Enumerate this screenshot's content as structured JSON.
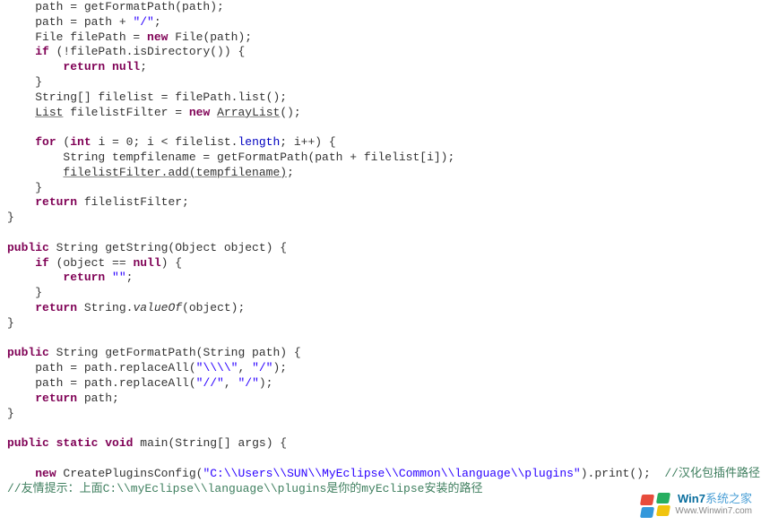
{
  "watermark": {
    "brand_prefix": "Win7",
    "brand_suffix": "系统之家",
    "url": "Www.Winwin7.com"
  },
  "lines": [
    {
      "indent": 4,
      "runs": [
        {
          "t": "path = getFormatPath(path);"
        }
      ]
    },
    {
      "indent": 4,
      "runs": [
        {
          "t": "path = path + "
        },
        {
          "t": "\"/\"",
          "cls": "str"
        },
        {
          "t": ";"
        }
      ]
    },
    {
      "indent": 4,
      "runs": [
        {
          "t": "File filePath = "
        },
        {
          "t": "new",
          "cls": "kw"
        },
        {
          "t": " File(path);"
        }
      ]
    },
    {
      "indent": 4,
      "runs": [
        {
          "t": "if",
          "cls": "kw"
        },
        {
          "t": " (!filePath.isDirectory()) {"
        }
      ]
    },
    {
      "indent": 8,
      "runs": [
        {
          "t": "return null",
          "cls": "kw"
        },
        {
          "t": ";"
        }
      ]
    },
    {
      "indent": 4,
      "runs": [
        {
          "t": "}"
        }
      ]
    },
    {
      "indent": 4,
      "runs": [
        {
          "t": "String[] filelist = filePath.list();"
        }
      ]
    },
    {
      "indent": 4,
      "runs": [
        {
          "t": "List",
          "cls": "u"
        },
        {
          "t": " filelistFilter = "
        },
        {
          "t": "new",
          "cls": "kw"
        },
        {
          "t": " "
        },
        {
          "t": "ArrayList",
          "cls": "u"
        },
        {
          "t": "();"
        }
      ]
    },
    {
      "indent": 0,
      "runs": [
        {
          "t": ""
        }
      ]
    },
    {
      "indent": 4,
      "runs": [
        {
          "t": "for",
          "cls": "kw"
        },
        {
          "t": " ("
        },
        {
          "t": "int",
          "cls": "kw"
        },
        {
          "t": " i = 0; i < filelist."
        },
        {
          "t": "length",
          "cls": "field"
        },
        {
          "t": "; i++) {"
        }
      ]
    },
    {
      "indent": 8,
      "runs": [
        {
          "t": "String tempfilename = getFormatPath(path + filelist[i]);"
        }
      ]
    },
    {
      "indent": 8,
      "runs": [
        {
          "t": "filelistFilter.add(tempfilename)",
          "cls": "u"
        },
        {
          "t": ";"
        }
      ]
    },
    {
      "indent": 4,
      "runs": [
        {
          "t": "}"
        }
      ]
    },
    {
      "indent": 4,
      "runs": [
        {
          "t": "return",
          "cls": "kw"
        },
        {
          "t": " filelistFilter;"
        }
      ]
    },
    {
      "indent": 0,
      "runs": [
        {
          "t": "}"
        }
      ]
    },
    {
      "indent": 0,
      "runs": [
        {
          "t": ""
        }
      ]
    },
    {
      "indent": 0,
      "runs": [
        {
          "t": "public",
          "cls": "kw"
        },
        {
          "t": " String getString(Object object) {"
        }
      ]
    },
    {
      "indent": 4,
      "runs": [
        {
          "t": "if",
          "cls": "kw"
        },
        {
          "t": " (object == "
        },
        {
          "t": "null",
          "cls": "kw"
        },
        {
          "t": ") {"
        }
      ]
    },
    {
      "indent": 8,
      "runs": [
        {
          "t": "return",
          "cls": "kw"
        },
        {
          "t": " "
        },
        {
          "t": "\"\"",
          "cls": "str"
        },
        {
          "t": ";"
        }
      ]
    },
    {
      "indent": 4,
      "runs": [
        {
          "t": "}"
        }
      ]
    },
    {
      "indent": 4,
      "runs": [
        {
          "t": "return",
          "cls": "kw"
        },
        {
          "t": " String."
        },
        {
          "t": "valueOf",
          "cls": ""
        },
        {
          "t": "(object);",
          "pre": true
        }
      ]
    },
    {
      "indent": 0,
      "runs": [
        {
          "t": "}"
        }
      ]
    },
    {
      "indent": 0,
      "runs": [
        {
          "t": ""
        }
      ]
    },
    {
      "indent": 0,
      "runs": [
        {
          "t": "public",
          "cls": "kw"
        },
        {
          "t": " String getFormatPath(String path) {"
        }
      ]
    },
    {
      "indent": 4,
      "runs": [
        {
          "t": "path = path.replaceAll("
        },
        {
          "t": "\"\\\\\\\\\"",
          "cls": "str"
        },
        {
          "t": ", "
        },
        {
          "t": "\"/\"",
          "cls": "str"
        },
        {
          "t": ");"
        }
      ]
    },
    {
      "indent": 4,
      "runs": [
        {
          "t": "path = path.replaceAll("
        },
        {
          "t": "\"//\"",
          "cls": "str"
        },
        {
          "t": ", "
        },
        {
          "t": "\"/\"",
          "cls": "str"
        },
        {
          "t": ");"
        }
      ]
    },
    {
      "indent": 4,
      "runs": [
        {
          "t": "return",
          "cls": "kw"
        },
        {
          "t": " path;"
        }
      ]
    },
    {
      "indent": 0,
      "runs": [
        {
          "t": "}"
        }
      ]
    },
    {
      "indent": 0,
      "runs": [
        {
          "t": ""
        }
      ]
    },
    {
      "indent": 0,
      "runs": [
        {
          "t": "public",
          "cls": "kw"
        },
        {
          "t": " "
        },
        {
          "t": "static",
          "cls": "kw"
        },
        {
          "t": " "
        },
        {
          "t": "void",
          "cls": "kw"
        },
        {
          "t": " main(String[] args) {"
        }
      ]
    },
    {
      "indent": 0,
      "runs": [
        {
          "t": ""
        }
      ]
    },
    {
      "indent": 4,
      "runs": [
        {
          "t": "new",
          "cls": "kw"
        },
        {
          "t": " CreatePluginsConfig("
        },
        {
          "t": "\"C:\\\\Users\\\\SUN\\\\MyEclipse\\\\Common\\\\language\\\\plugins\"",
          "cls": "str"
        },
        {
          "t": ").print();  "
        },
        {
          "t": "//汉化包插件路径",
          "cls": "com"
        }
      ]
    },
    {
      "indent": 0,
      "runs": [
        {
          "t": "//友情提示：上面C:\\\\myEclipse\\\\language\\\\plugins是你的myEclipse安装的路径",
          "cls": "com"
        }
      ]
    }
  ]
}
